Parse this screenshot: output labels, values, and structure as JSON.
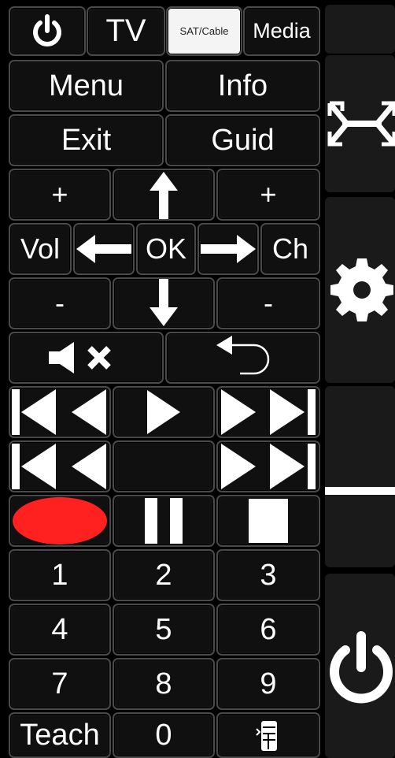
{
  "top_tabs": {
    "power_icon": "power-icon",
    "tv": "TV",
    "sat_cable": "SAT/Cable",
    "media": "Media"
  },
  "row_menu": {
    "menu": "Menu",
    "info": "Info"
  },
  "row_exit": {
    "exit": "Exit",
    "guide": "Guid"
  },
  "vol_ch": {
    "plus": "+",
    "minus": "-",
    "vol": "Vol",
    "ok": "OK",
    "ch": "Ch"
  },
  "audio": {
    "mute_icon": "mute-icon",
    "back_icon": "back-arrow-icon"
  },
  "transport": {
    "prev_icon": "skip-back-icon",
    "play_icon": "play-icon",
    "next_icon": "skip-forward-icon",
    "rewind_icon": "rewind-icon",
    "ff_icon": "fast-forward-icon",
    "record_icon": "record-icon",
    "pause_icon": "pause-icon",
    "stop_icon": "stop-icon",
    "record_color": "#ff2020"
  },
  "numpad": {
    "n1": "1",
    "n2": "2",
    "n3": "3",
    "n4": "4",
    "n5": "5",
    "n6": "6",
    "n7": "7",
    "n8": "8",
    "n9": "9",
    "n0": "0",
    "teach": "Teach"
  },
  "side": {
    "fullscreen_icon": "fullscreen-icon",
    "settings_icon": "gear-icon",
    "power_icon": "power-icon"
  }
}
